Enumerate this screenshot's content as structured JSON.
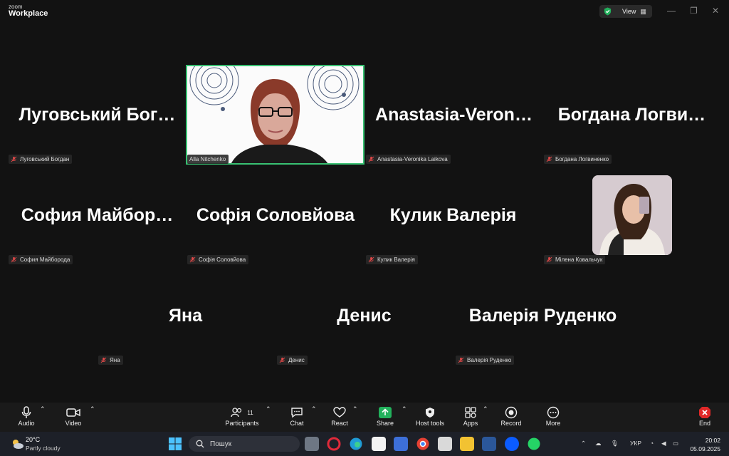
{
  "app": {
    "logo_top": "zoom",
    "logo_bottom": "Workplace",
    "view_label": "View"
  },
  "participants": [
    {
      "tile_name": "Луговський  Бог…",
      "label": "Луговський Богдан"
    },
    {
      "label": "Alla Nitchenko"
    },
    {
      "tile_name": "Anastasia-Veron…",
      "label": "Anastasia-Veronika Laikova"
    },
    {
      "tile_name": "Богдана  Логви…",
      "label": "Богдана Логвиненко"
    },
    {
      "tile_name": "София  Майбор…",
      "label": "София Майборода"
    },
    {
      "tile_name": "Софія Соловйова",
      "label": "Софія Соловйова"
    },
    {
      "tile_name": "Кулик Валерія",
      "label": "Кулик Валерія"
    },
    {
      "label": "Мілена Ковальчук"
    },
    {
      "tile_name": "Яна",
      "label": "Яна"
    },
    {
      "tile_name": "Денис",
      "label": "Денис"
    },
    {
      "tile_name": "Валерія Руденко",
      "label": "Валерія Руденко"
    }
  ],
  "toolbar": {
    "audio": "Audio",
    "video": "Video",
    "participants": "Participants",
    "participants_count": "11",
    "chat": "Chat",
    "react": "React",
    "share": "Share",
    "host_tools": "Host tools",
    "apps": "Apps",
    "record": "Record",
    "more": "More",
    "end": "End"
  },
  "taskbar": {
    "weather_temp": "20°C",
    "weather_desc": "Partly cloudy",
    "search_placeholder": "Пошук",
    "language": "УКР",
    "time": "20:02",
    "date": "05.09.2025"
  },
  "colors": {
    "accent_green": "#38c172",
    "share_green": "#22b15c",
    "end_red": "#e02828",
    "mic_muted": "#e04848"
  },
  "icons": [
    "shield-check-icon",
    "grid-icon",
    "microphone-icon",
    "camera-icon",
    "participants-icon",
    "chat-icon",
    "heart-icon",
    "share-arrow-icon",
    "host-shield-icon",
    "apps-icon",
    "record-icon",
    "more-icon",
    "end-icon",
    "windows-icon",
    "search-icon"
  ]
}
